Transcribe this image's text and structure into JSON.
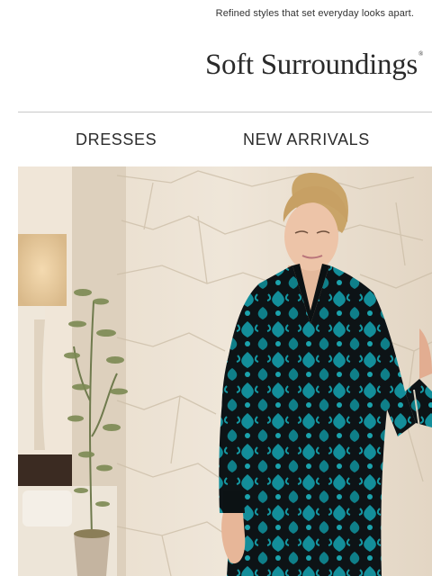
{
  "header": {
    "tagline": "Refined styles that set everyday looks apart.",
    "logo": "Soft Surroundings",
    "logo_mark": "®"
  },
  "nav": {
    "items": [
      {
        "label": "DRESSES"
      },
      {
        "label": "NEW ARRIVALS"
      }
    ]
  },
  "hero": {
    "dress_colors": [
      "#0f8f9a",
      "#111416"
    ]
  }
}
